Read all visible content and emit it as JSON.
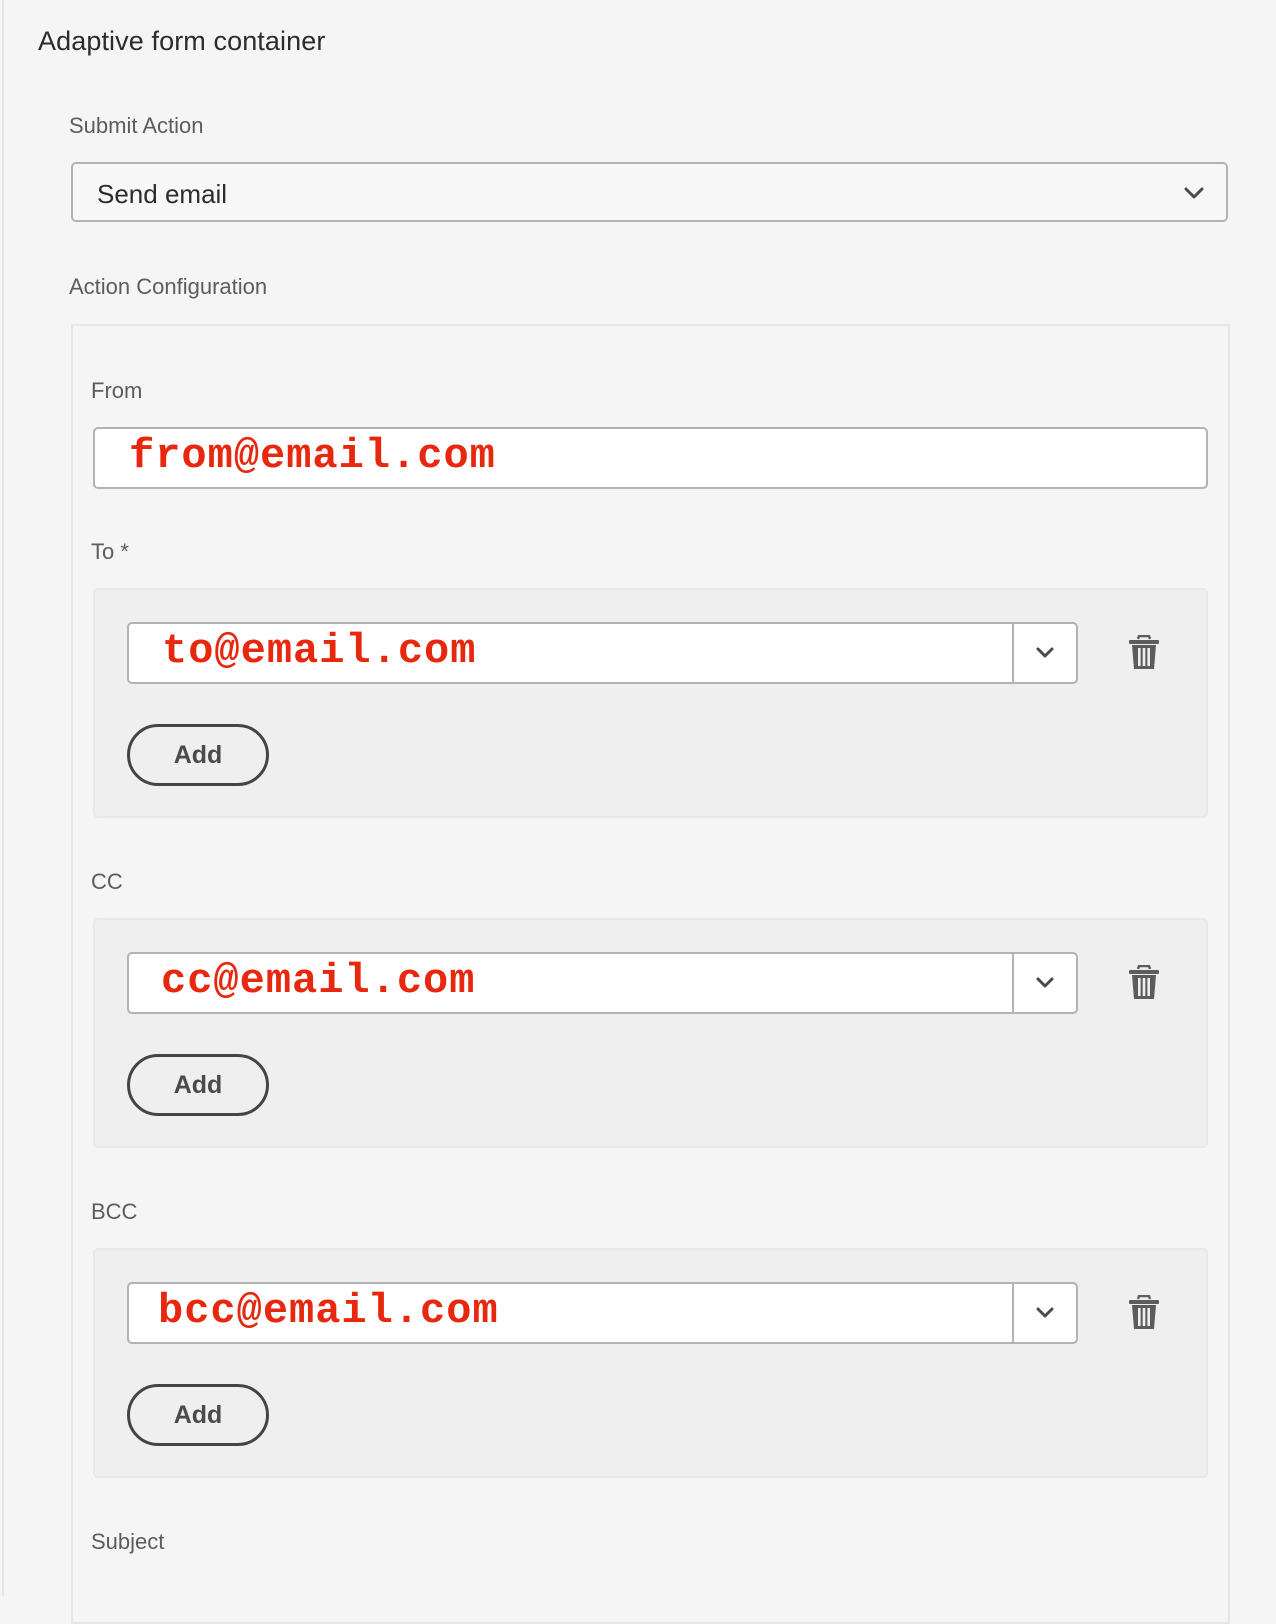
{
  "container": {
    "title": "Adaptive form container"
  },
  "submit_action": {
    "label": "Submit Action",
    "value": "Send email",
    "icon": "chevron-down-icon"
  },
  "action_configuration": {
    "label": "Action Configuration",
    "from": {
      "label": "From",
      "value": "from@email.com"
    },
    "to": {
      "label": "To *",
      "value": "to@email.com",
      "add_label": "Add"
    },
    "cc": {
      "label": "CC",
      "value": "cc@email.com",
      "add_label": "Add"
    },
    "bcc": {
      "label": "BCC",
      "value": "bcc@email.com",
      "add_label": "Add"
    },
    "subject": {
      "label": "Subject"
    }
  },
  "colors": {
    "annotation_red": "#e8280e",
    "text_dark": "#2c2c2c",
    "label_gray": "#5c5c5c"
  }
}
